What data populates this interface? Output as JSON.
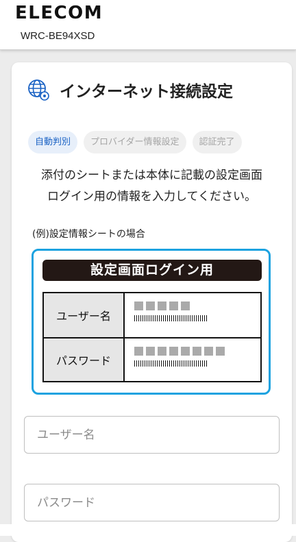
{
  "header": {
    "brand": "ELECOM",
    "model": "WRC-BE94XSD"
  },
  "page": {
    "title": "インターネット接続設定",
    "title_icon": "globe-settings-icon"
  },
  "steps": [
    {
      "label": "自動判別",
      "active": true
    },
    {
      "label": "プロバイダー情報設定",
      "active": false
    },
    {
      "label": "認証完了",
      "active": false
    }
  ],
  "description": {
    "line1": "添付のシートまたは本体に記載の設定画面",
    "line2": "ログイン用の情報を入力してください。"
  },
  "example": {
    "label": "(例)設定情報シートの場合",
    "sheet_title": "設定画面ログイン用",
    "rows": [
      {
        "label": "ユーザー名",
        "masked_blocks": 5
      },
      {
        "label": "パスワード",
        "masked_blocks": 8
      }
    ]
  },
  "form": {
    "username_placeholder": "ユーザー名",
    "password_placeholder": "パスワード"
  },
  "colors": {
    "accent": "#1a62c4",
    "active_step_bg": "#e7effa",
    "sheet_border": "#1ba2e0"
  }
}
